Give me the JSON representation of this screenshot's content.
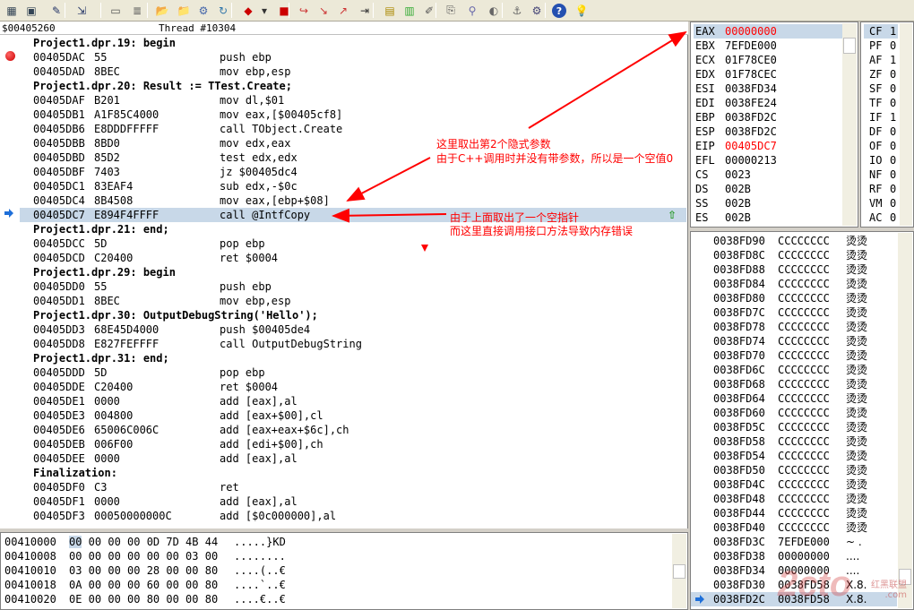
{
  "toolbar": {
    "icons": [
      "module-window-icon",
      "cpu-window-icon",
      "new-file-icon",
      "step-into-icon",
      "window-icon",
      "list-icon",
      "open-folder-icon",
      "save-folder-icon",
      "find-icon",
      "refresh-icon",
      "run-icon",
      "dropdown-icon",
      "stop-icon",
      "step-over-icon",
      "step-in-icon",
      "step-out-icon",
      "run-to-cursor-icon",
      "grid-icon",
      "chart-icon",
      "edit-icon",
      "copy-icon",
      "attach-icon",
      "palette-icon",
      "hook-icon",
      "settings-gear-icon",
      "help-icon",
      "tip-bulb-icon"
    ]
  },
  "disasm": {
    "header_address": "$00405260",
    "header_thread": "Thread #10304",
    "rows": [
      {
        "type": "src",
        "text": "Project1.dpr.19: begin"
      },
      {
        "type": "asm",
        "addr": "00405DAC",
        "bytes": "55",
        "asm": "push ebp",
        "bp": true
      },
      {
        "type": "asm",
        "addr": "00405DAD",
        "bytes": "8BEC",
        "asm": "mov ebp,esp"
      },
      {
        "type": "src",
        "text": "Project1.dpr.20: Result := TTest.Create;"
      },
      {
        "type": "asm",
        "addr": "00405DAF",
        "bytes": "B201",
        "asm": "mov dl,$01"
      },
      {
        "type": "asm",
        "addr": "00405DB1",
        "bytes": "A1F85C4000",
        "asm": "mov eax,[$00405cf8]"
      },
      {
        "type": "asm",
        "addr": "00405DB6",
        "bytes": "E8DDDFFFFF",
        "asm": "call TObject.Create"
      },
      {
        "type": "asm",
        "addr": "00405DBB",
        "bytes": "8BD0",
        "asm": "mov edx,eax"
      },
      {
        "type": "asm",
        "addr": "00405DBD",
        "bytes": "85D2",
        "asm": "test edx,edx"
      },
      {
        "type": "asm",
        "addr": "00405DBF",
        "bytes": "7403",
        "asm": "jz $00405dc4"
      },
      {
        "type": "asm",
        "addr": "00405DC1",
        "bytes": "83EAF4",
        "asm": "sub edx,-$0c"
      },
      {
        "type": "asm",
        "addr": "00405DC4",
        "bytes": "8B4508",
        "asm": "mov eax,[ebp+$08]"
      },
      {
        "type": "asm",
        "addr": "00405DC7",
        "bytes": "E894F4FFFF",
        "asm": "call @IntfCopy",
        "current": true
      },
      {
        "type": "src",
        "text": "Project1.dpr.21: end;"
      },
      {
        "type": "asm",
        "addr": "00405DCC",
        "bytes": "5D",
        "asm": "pop ebp"
      },
      {
        "type": "asm",
        "addr": "00405DCD",
        "bytes": "C20400",
        "asm": "ret $0004"
      },
      {
        "type": "src",
        "text": "Project1.dpr.29: begin"
      },
      {
        "type": "asm",
        "addr": "00405DD0",
        "bytes": "55",
        "asm": "push ebp"
      },
      {
        "type": "asm",
        "addr": "00405DD1",
        "bytes": "8BEC",
        "asm": "mov ebp,esp"
      },
      {
        "type": "src",
        "text": "Project1.dpr.30: OutputDebugString('Hello');"
      },
      {
        "type": "asm",
        "addr": "00405DD3",
        "bytes": "68E45D4000",
        "asm": "push $00405de4"
      },
      {
        "type": "asm",
        "addr": "00405DD8",
        "bytes": "E827FEFFFF",
        "asm": "call OutputDebugString"
      },
      {
        "type": "src",
        "text": "Project1.dpr.31: end;"
      },
      {
        "type": "asm",
        "addr": "00405DDD",
        "bytes": "5D",
        "asm": "pop ebp"
      },
      {
        "type": "asm",
        "addr": "00405DDE",
        "bytes": "C20400",
        "asm": "ret $0004"
      },
      {
        "type": "asm",
        "addr": "00405DE1",
        "bytes": "0000",
        "asm": "add [eax],al"
      },
      {
        "type": "asm",
        "addr": "00405DE3",
        "bytes": "004800",
        "asm": "add [eax+$00],cl"
      },
      {
        "type": "asm",
        "addr": "00405DE6",
        "bytes": "65006C006C",
        "asm": "add [eax+eax+$6c],ch"
      },
      {
        "type": "asm",
        "addr": "00405DEB",
        "bytes": "006F00",
        "asm": "add [edi+$00],ch"
      },
      {
        "type": "asm",
        "addr": "00405DEE",
        "bytes": "0000",
        "asm": "add [eax],al"
      },
      {
        "type": "src",
        "text": "Finalization:"
      },
      {
        "type": "asm",
        "addr": "00405DF0",
        "bytes": "C3",
        "asm": "ret"
      },
      {
        "type": "asm",
        "addr": "00405DF1",
        "bytes": "0000",
        "asm": "add [eax],al"
      },
      {
        "type": "asm",
        "addr": "00405DF3",
        "bytes": "00050000000C",
        "asm": "add [$0c000000],al"
      }
    ]
  },
  "registers": [
    {
      "name": "EAX",
      "value": "00000000",
      "changed": true,
      "selected": true
    },
    {
      "name": "EBX",
      "value": "7EFDE000"
    },
    {
      "name": "ECX",
      "value": "01F78CE0"
    },
    {
      "name": "EDX",
      "value": "01F78CEC"
    },
    {
      "name": "ESI",
      "value": "0038FD34"
    },
    {
      "name": "EDI",
      "value": "0038FE24"
    },
    {
      "name": "EBP",
      "value": "0038FD2C"
    },
    {
      "name": "ESP",
      "value": "0038FD2C"
    },
    {
      "name": "EIP",
      "value": "00405DC7",
      "changed": true
    },
    {
      "name": "EFL",
      "value": "00000213"
    },
    {
      "name": "CS",
      "value": "0023"
    },
    {
      "name": "DS",
      "value": "002B"
    },
    {
      "name": "SS",
      "value": "002B"
    },
    {
      "name": "ES",
      "value": "002B"
    }
  ],
  "flags": [
    {
      "name": "CF",
      "value": "1",
      "selected": true
    },
    {
      "name": "PF",
      "value": "0"
    },
    {
      "name": "AF",
      "value": "1"
    },
    {
      "name": "ZF",
      "value": "0"
    },
    {
      "name": "SF",
      "value": "0"
    },
    {
      "name": "TF",
      "value": "0"
    },
    {
      "name": "IF",
      "value": "1"
    },
    {
      "name": "DF",
      "value": "0"
    },
    {
      "name": "OF",
      "value": "0"
    },
    {
      "name": "IO",
      "value": "0"
    },
    {
      "name": "NF",
      "value": "0"
    },
    {
      "name": "RF",
      "value": "0"
    },
    {
      "name": "VM",
      "value": "0"
    },
    {
      "name": "AC",
      "value": "0"
    }
  ],
  "stack": [
    {
      "addr": "0038FD90",
      "value": "CCCCCCCC",
      "chars": "烫烫"
    },
    {
      "addr": "0038FD8C",
      "value": "CCCCCCCC",
      "chars": "烫烫"
    },
    {
      "addr": "0038FD88",
      "value": "CCCCCCCC",
      "chars": "烫烫"
    },
    {
      "addr": "0038FD84",
      "value": "CCCCCCCC",
      "chars": "烫烫"
    },
    {
      "addr": "0038FD80",
      "value": "CCCCCCCC",
      "chars": "烫烫"
    },
    {
      "addr": "0038FD7C",
      "value": "CCCCCCCC",
      "chars": "烫烫"
    },
    {
      "addr": "0038FD78",
      "value": "CCCCCCCC",
      "chars": "烫烫"
    },
    {
      "addr": "0038FD74",
      "value": "CCCCCCCC",
      "chars": "烫烫"
    },
    {
      "addr": "0038FD70",
      "value": "CCCCCCCC",
      "chars": "烫烫"
    },
    {
      "addr": "0038FD6C",
      "value": "CCCCCCCC",
      "chars": "烫烫"
    },
    {
      "addr": "0038FD68",
      "value": "CCCCCCCC",
      "chars": "烫烫"
    },
    {
      "addr": "0038FD64",
      "value": "CCCCCCCC",
      "chars": "烫烫"
    },
    {
      "addr": "0038FD60",
      "value": "CCCCCCCC",
      "chars": "烫烫"
    },
    {
      "addr": "0038FD5C",
      "value": "CCCCCCCC",
      "chars": "烫烫"
    },
    {
      "addr": "0038FD58",
      "value": "CCCCCCCC",
      "chars": "烫烫"
    },
    {
      "addr": "0038FD54",
      "value": "CCCCCCCC",
      "chars": "烫烫"
    },
    {
      "addr": "0038FD50",
      "value": "CCCCCCCC",
      "chars": "烫烫"
    },
    {
      "addr": "0038FD4C",
      "value": "CCCCCCCC",
      "chars": "烫烫"
    },
    {
      "addr": "0038FD48",
      "value": "CCCCCCCC",
      "chars": "烫烫"
    },
    {
      "addr": "0038FD44",
      "value": "CCCCCCCC",
      "chars": "烫烫"
    },
    {
      "addr": "0038FD40",
      "value": "CCCCCCCC",
      "chars": "烫烫"
    },
    {
      "addr": "0038FD3C",
      "value": "7EFDE000",
      "chars": "~ ."
    },
    {
      "addr": "0038FD38",
      "value": "00000000",
      "chars": "...."
    },
    {
      "addr": "0038FD34",
      "value": "00000000",
      "chars": "...."
    },
    {
      "addr": "0038FD30",
      "value": "0038FD58",
      "chars": "X.8."
    },
    {
      "addr": "0038FD2C",
      "value": "0038FD58",
      "chars": "X.8.",
      "current": true
    }
  ],
  "dump": [
    {
      "addr": "00410000",
      "first": "00",
      "rest": " 00 00 00 0D 7D 4B 44",
      "chars": ".....}KD"
    },
    {
      "addr": "00410008",
      "first": "00",
      "rest": " 00 00 00 00 00 03 00",
      "chars": "........"
    },
    {
      "addr": "00410010",
      "first": "03",
      "rest": " 00 00 00 28 00 00 80",
      "chars": "....(..€"
    },
    {
      "addr": "00410018",
      "first": "0A",
      "rest": " 00 00 00 60 00 00 80",
      "chars": "....`..€"
    },
    {
      "addr": "00410020",
      "first": "0E",
      "rest": " 00 00 00 80 00 00 80",
      "chars": "....€..€"
    }
  ],
  "annotations": {
    "note1_line1": "这里取出第2个隐式参数",
    "note1_line2": "由于C++调用时并没有带参数，所以是一个空值0",
    "note2_line1": "由于上面取出了一个空指针",
    "note2_line2": "而这里直接调用接口方法导致内存错误"
  },
  "watermark": {
    "logo": "2cto",
    "sub": "红黑联盟",
    "sub2": ".com"
  },
  "colors": {
    "selection": "#c8d8e8",
    "changed_register": "#ff0000",
    "annotation": "#ff0000",
    "breakpoint": "#cc0000",
    "ip_arrow": "#1e6fd9"
  }
}
